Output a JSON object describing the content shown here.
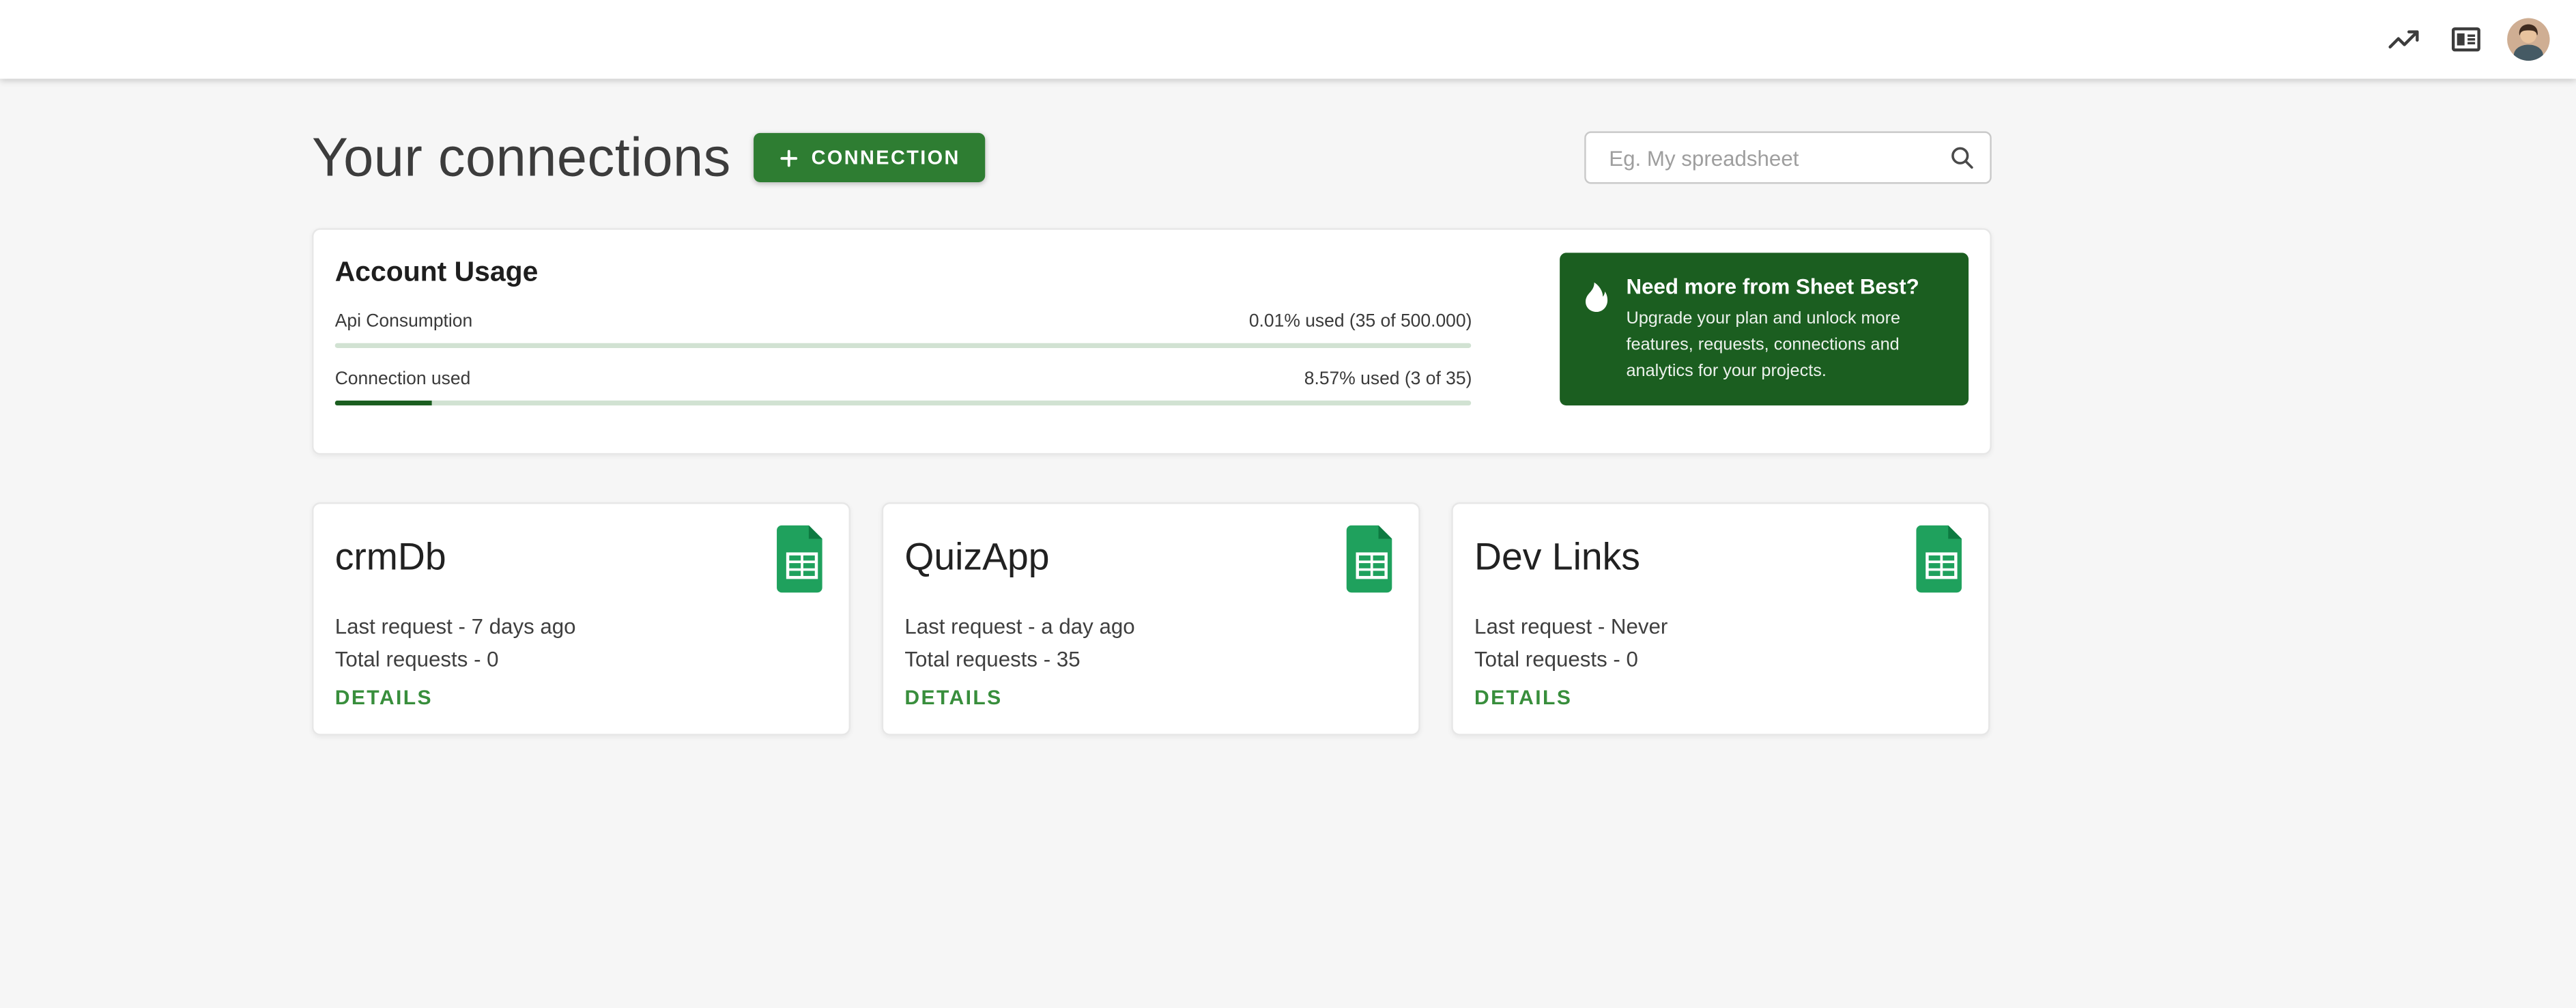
{
  "header": {
    "icons": {
      "analytics": "trending-chart-icon",
      "reader": "reader-mode-icon",
      "avatar": "user-avatar"
    }
  },
  "page": {
    "title": "Your connections",
    "connection_button_label": "CONNECTION",
    "search_placeholder": "Eg. My spreadsheet"
  },
  "usage": {
    "title": "Account Usage",
    "metrics": [
      {
        "label": "Api Consumption",
        "value_text": "0.01% used (35 of 500.000)",
        "percent": 0.01
      },
      {
        "label": "Connection used",
        "value_text": "8.57% used (3 of 35)",
        "percent": 8.57
      }
    ],
    "promo": {
      "title": "Need more from Sheet Best?",
      "body": "Upgrade your plan and unlock more features, requests, connections and analytics for your projects."
    }
  },
  "connections": [
    {
      "name": "crmDb",
      "last_request": "Last request - 7 days ago",
      "total_requests": "Total requests - 0",
      "details_label": "DETAILS"
    },
    {
      "name": "QuizApp",
      "last_request": "Last request - a day ago",
      "total_requests": "Total requests - 35",
      "details_label": "DETAILS"
    },
    {
      "name": "Dev Links",
      "last_request": "Last request - Never",
      "total_requests": "Total requests - 0",
      "details_label": "DETAILS"
    }
  ],
  "colors": {
    "primary_green": "#2e7d32",
    "dark_green": "#1b5e20",
    "details_green": "#388e3c",
    "sheets_icon_green": "#1fa15d",
    "page_background": "#f6f6f6"
  }
}
